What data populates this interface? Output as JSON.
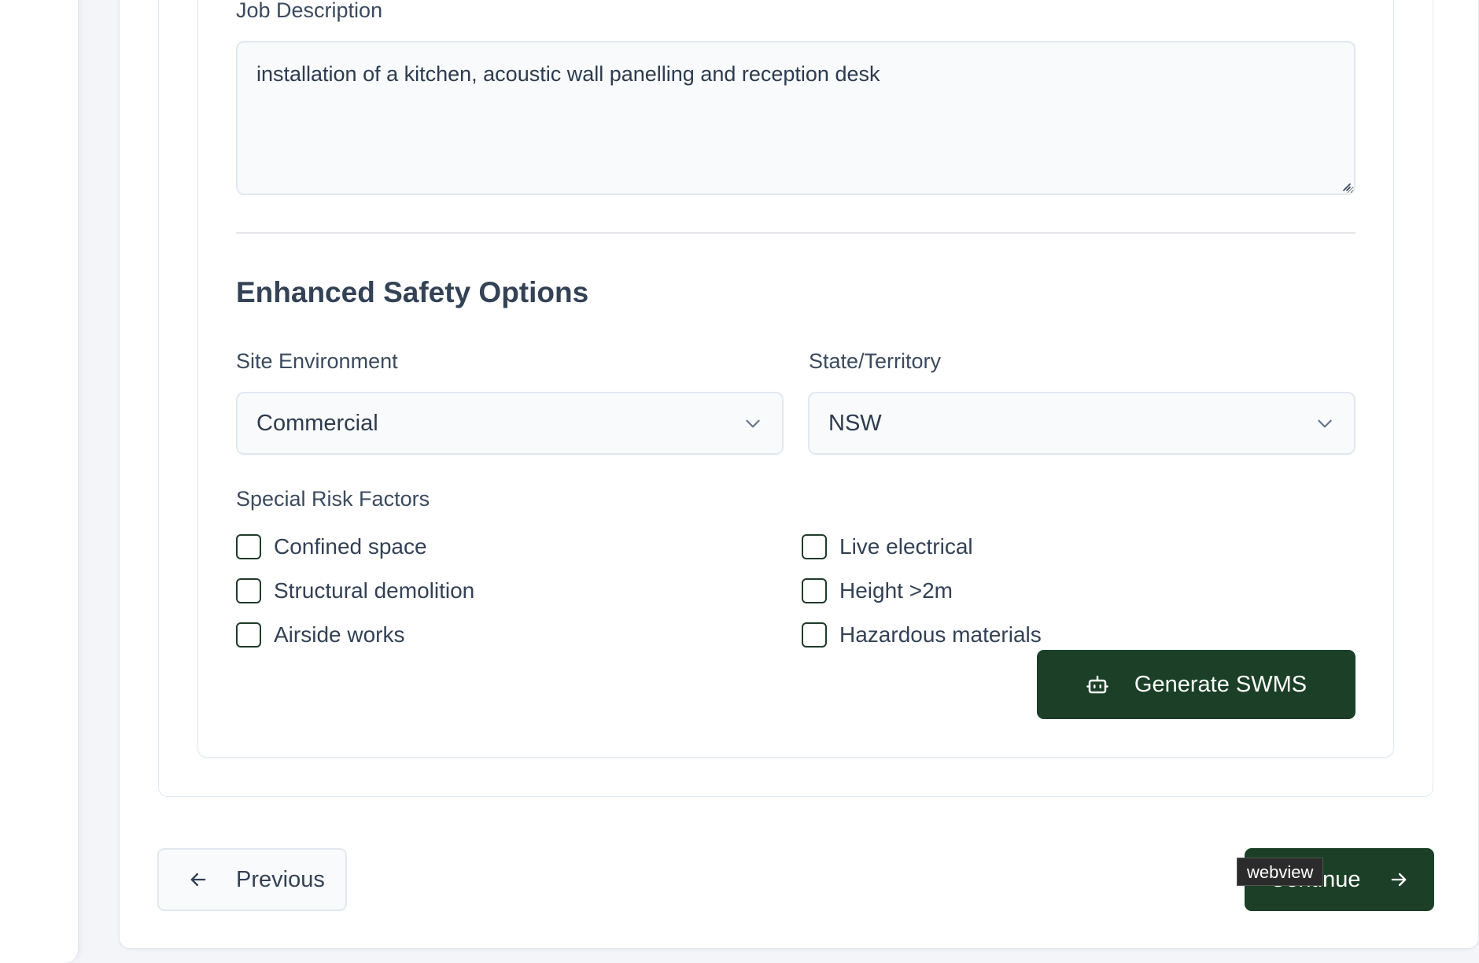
{
  "job_description": {
    "label": "Job Description",
    "value": "installation of a kitchen, acoustic wall panelling and reception desk"
  },
  "enhanced_safety": {
    "title": "Enhanced Safety Options",
    "site_environment": {
      "label": "Site Environment",
      "selected": "Commercial"
    },
    "state_territory": {
      "label": "State/Territory",
      "selected": "NSW"
    },
    "special_risk_factors": {
      "label": "Special Risk Factors",
      "options": [
        {
          "label": "Confined space",
          "checked": false
        },
        {
          "label": "Live electrical",
          "checked": false
        },
        {
          "label": "Structural demolition",
          "checked": false
        },
        {
          "label": "Height >2m",
          "checked": false
        },
        {
          "label": "Airside works",
          "checked": false
        },
        {
          "label": "Hazardous materials",
          "checked": false
        }
      ]
    },
    "generate_button": {
      "label": "Generate SWMS",
      "icon": "robot-icon"
    }
  },
  "navigation": {
    "previous_label": "Previous",
    "continue_label": "Continue"
  },
  "tooltip": {
    "text": "webview"
  },
  "colors": {
    "primary": "#1b4027",
    "text": "#334155",
    "border": "#e2e8f0",
    "field_bg": "#f8fafc"
  }
}
